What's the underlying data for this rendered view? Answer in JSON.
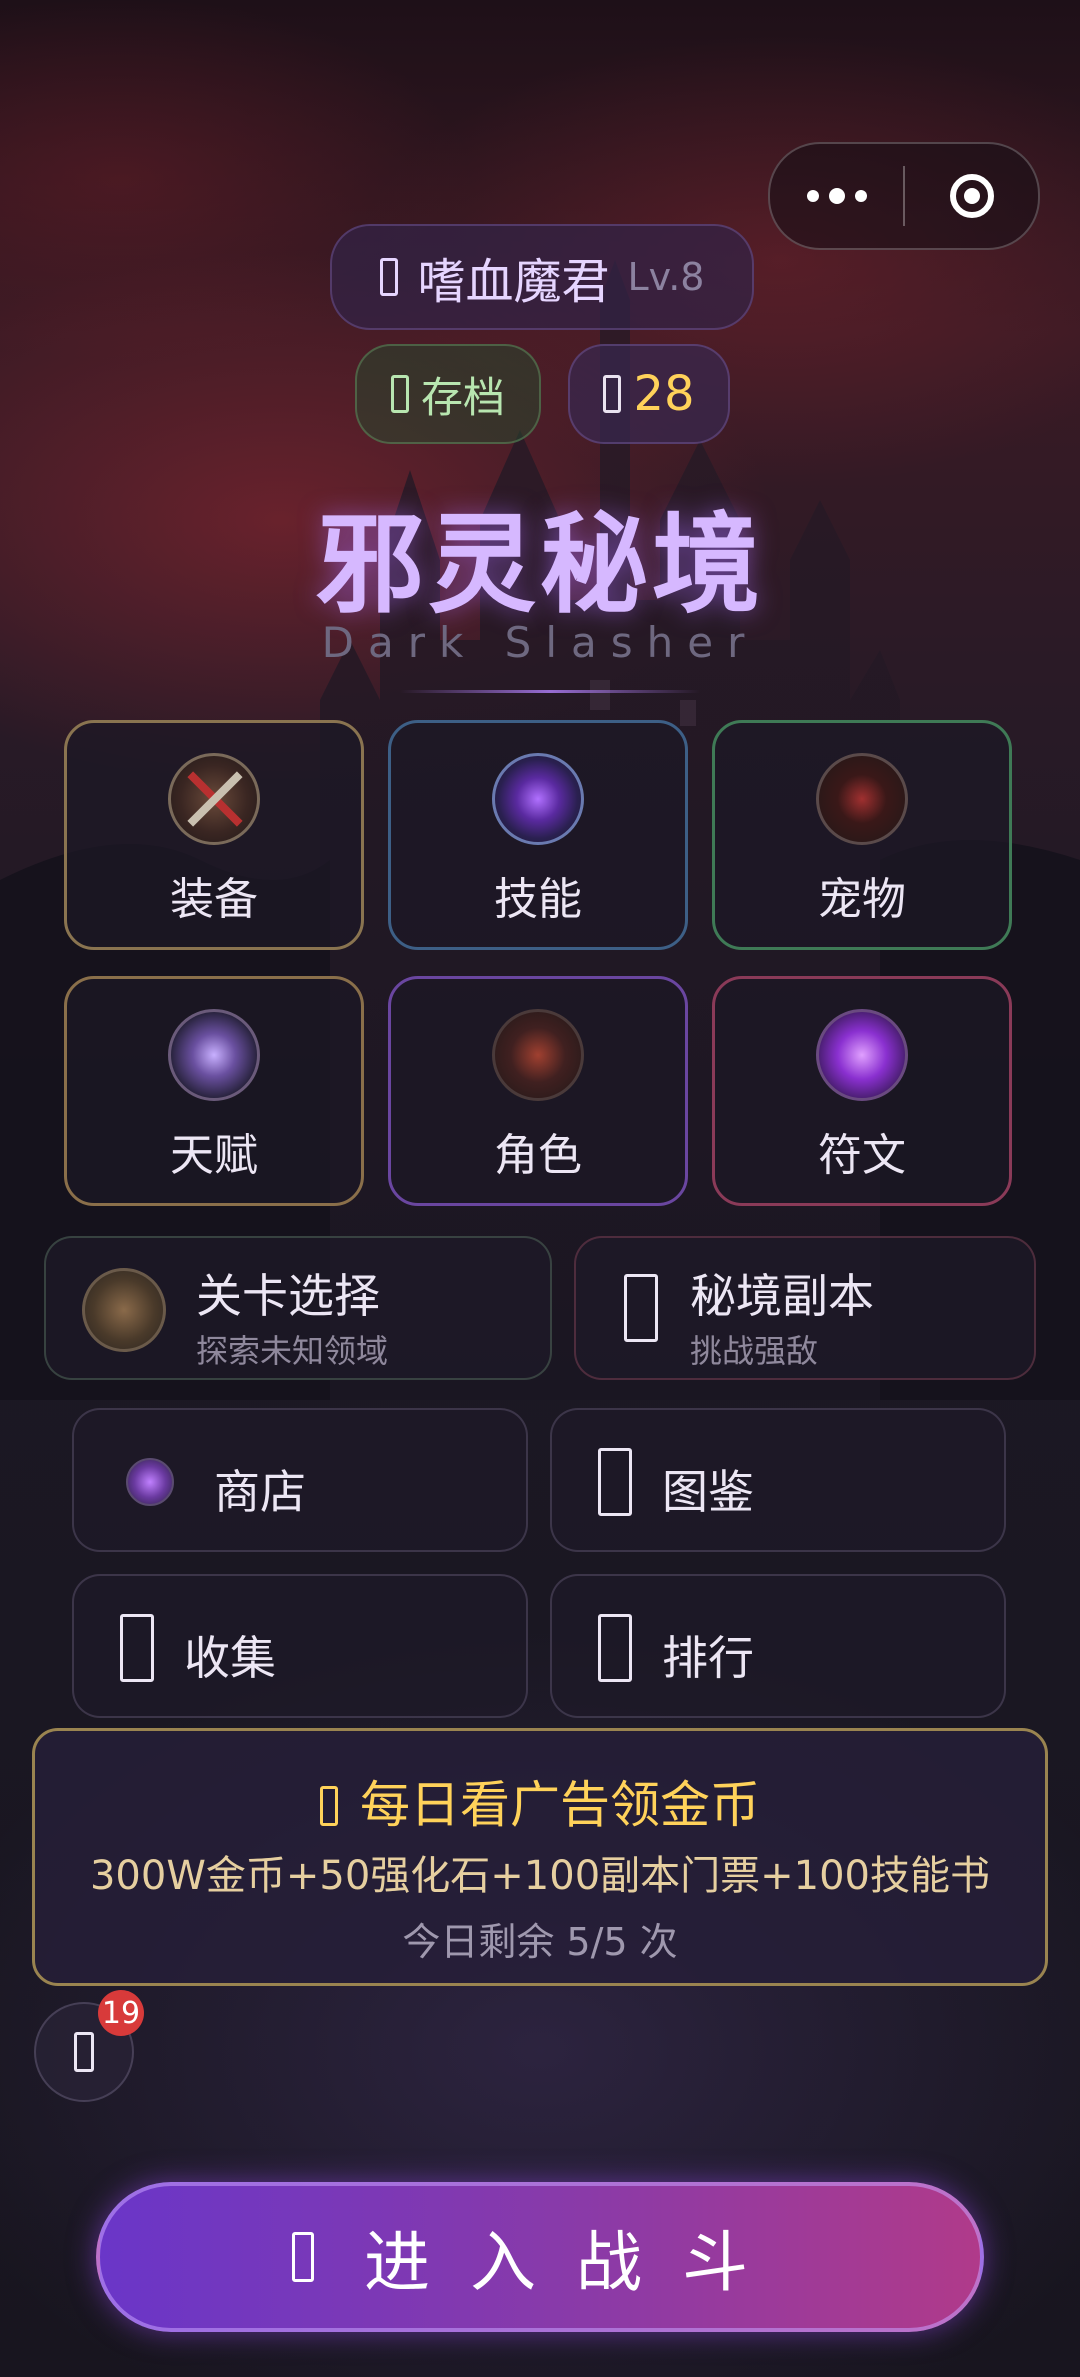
{
  "player": {
    "name": "嗜血魔君",
    "level": "Lv.8"
  },
  "save_label": "存档",
  "gems_count": "28",
  "title": "邪灵秘境",
  "subtitle": "Dark Slasher",
  "grid": [
    {
      "label": "装备",
      "icon": "sword-icon",
      "border": "#8a7450"
    },
    {
      "label": "技能",
      "icon": "skill-orb-icon",
      "border": "#3d5f86"
    },
    {
      "label": "宠物",
      "icon": "pet-demon-icon",
      "border": "#3f7a56"
    },
    {
      "label": "天赋",
      "icon": "talent-tree-icon",
      "border": "#8a6f4a"
    },
    {
      "label": "角色",
      "icon": "character-helmet-icon",
      "border": "#6a46a0"
    },
    {
      "label": "符文",
      "icon": "rune-icon",
      "border": "#8a3a58"
    }
  ],
  "stage_select": {
    "title": "关卡选择",
    "desc": "探索未知领域"
  },
  "dungeon": {
    "title": "秘境副本",
    "desc": "挑战强敌"
  },
  "shop": {
    "label": "商店"
  },
  "codex": {
    "label": "图鉴"
  },
  "collect": {
    "label": "收集"
  },
  "ranking": {
    "label": "排行"
  },
  "ad": {
    "title": "每日看广告领金币",
    "rewards": "300W金币+50强化石+100副本门票+100技能书",
    "remaining": "今日剩余 5/5 次"
  },
  "mail_badge": "19",
  "battle_button": "进入战斗"
}
